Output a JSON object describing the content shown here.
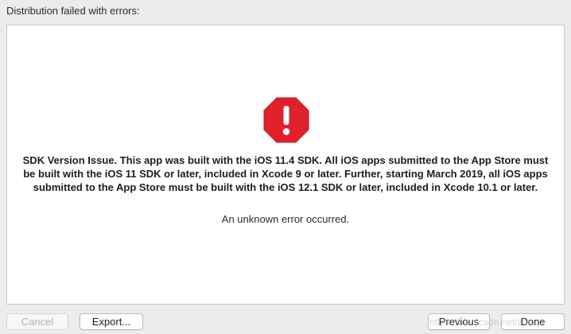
{
  "header": {
    "title": "Distribution failed with errors:"
  },
  "main": {
    "icon": "stop-octagon-icon",
    "icon_color": "#e0202b",
    "message": "SDK Version Issue. This app was built with the iOS 11.4 SDK. All iOS apps submitted to the App Store must be built with the iOS 11 SDK or later, included in Xcode 9 or later. Further, starting March 2019, all iOS apps submitted to the App Store must be built with the iOS 12.1 SDK or later, included in Xcode 10.1 or later.",
    "sub_message": "An unknown error occurred."
  },
  "footer": {
    "cancel_label": "Cancel",
    "export_label": "Export...",
    "previous_label": "Previous",
    "done_label": "Done"
  },
  "watermark": {
    "text": "https://blog.csdn.net/zonx"
  }
}
